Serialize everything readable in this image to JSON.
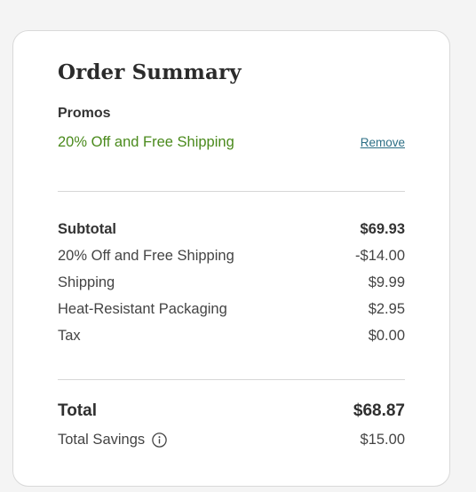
{
  "order_summary": {
    "title": "Order Summary",
    "promos": {
      "heading": "Promos",
      "applied_name": "20% Off and Free Shipping",
      "remove_label": "Remove"
    },
    "line_items": [
      {
        "label": "Subtotal",
        "value": "$69.93"
      },
      {
        "label": "20% Off and Free Shipping",
        "value": "-$14.00"
      },
      {
        "label": "Shipping",
        "value": "$9.99"
      },
      {
        "label": "Heat-Resistant Packaging",
        "value": "$2.95"
      },
      {
        "label": "Tax",
        "value": "$0.00"
      }
    ],
    "total": {
      "label": "Total",
      "value": "$68.87"
    },
    "savings": {
      "label": "Total Savings",
      "value": "$15.00",
      "icon": "info-icon"
    }
  },
  "colors": {
    "promo_green": "#4a8a1c",
    "link": "#2d6f86",
    "background": "#f4f4f4",
    "card": "#ffffff"
  }
}
